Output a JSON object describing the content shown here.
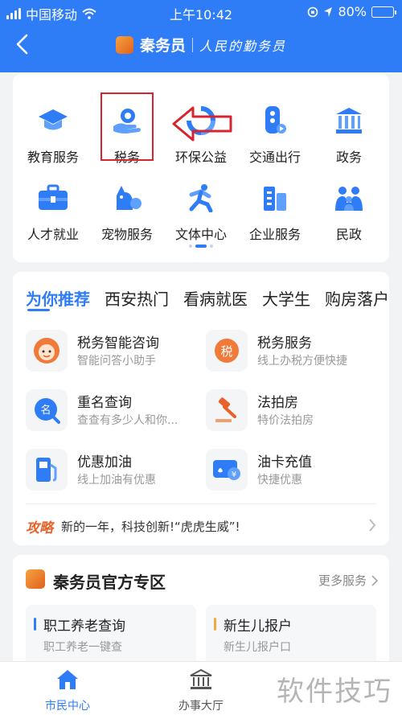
{
  "status_bar": {
    "carrier": "中国移动",
    "time": "上午10:42",
    "battery": "80%"
  },
  "header": {
    "brand_name": "秦务员",
    "slogan": "人民的勤务员"
  },
  "services": [
    {
      "label": "教育服务",
      "icon": "graduation-cap-icon"
    },
    {
      "label": "税务",
      "icon": "tax-hand-icon"
    },
    {
      "label": "环保公益",
      "icon": "recycle-icon"
    },
    {
      "label": "交通出行",
      "icon": "traffic-light-icon"
    },
    {
      "label": "政务",
      "icon": "government-building-icon"
    },
    {
      "label": "人才就业",
      "icon": "briefcase-icon"
    },
    {
      "label": "宠物服务",
      "icon": "pet-icon"
    },
    {
      "label": "文体中心",
      "icon": "running-figure-icon"
    },
    {
      "label": "企业服务",
      "icon": "office-building-icon"
    },
    {
      "label": "民政",
      "icon": "family-icon"
    }
  ],
  "recommend": {
    "tabs": [
      "为你推荐",
      "西安热门",
      "看病就医",
      "大学生",
      "购房落户"
    ],
    "items": [
      {
        "title": "税务智能咨询",
        "subtitle": "智能问答小助手",
        "icon": "assistant-avatar-icon"
      },
      {
        "title": "税务服务",
        "subtitle": "线上办税方便快捷",
        "icon": "tax-badge-icon"
      },
      {
        "title": "重名查询",
        "subtitle": "查查有多少人和你...",
        "icon": "name-search-icon"
      },
      {
        "title": "法拍房",
        "subtitle": "特价法拍房",
        "icon": "gavel-icon"
      },
      {
        "title": "优惠加油",
        "subtitle": "线上加油有优惠",
        "icon": "fuel-pump-icon"
      },
      {
        "title": "油卡充值",
        "subtitle": "快捷优惠",
        "icon": "card-recharge-icon"
      }
    ],
    "strategy_tag": "攻略",
    "strategy_text": "新的一年，科技创新!“虎虎生威”!"
  },
  "official_zone": {
    "title": "秦务员官方专区",
    "more": "更多服务",
    "items": [
      {
        "title": "职工养老查询",
        "subtitle": "职工养老一键查",
        "color": "#2f7df6"
      },
      {
        "title": "新生儿报户",
        "subtitle": "新生儿报户口",
        "color": "#f2a93b"
      }
    ]
  },
  "tabbar": [
    {
      "label": "市民中心",
      "icon": "home-icon",
      "active": true
    },
    {
      "label": "办事大厅",
      "icon": "hall-icon",
      "active": false
    }
  ],
  "watermark": "软件技巧",
  "colors": {
    "primary": "#2f7df6",
    "highlight_box": "#d6252f",
    "accent_orange": "#e8622a"
  }
}
